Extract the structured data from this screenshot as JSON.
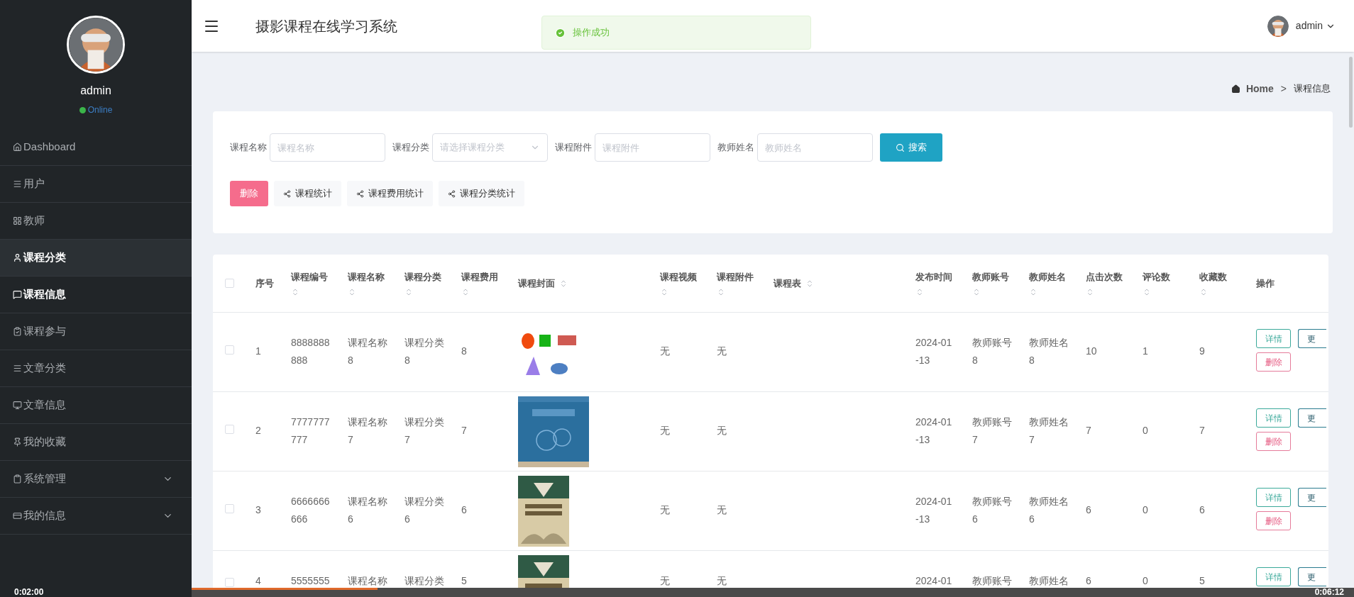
{
  "sidebar": {
    "user": {
      "name": "admin",
      "status": "Online"
    },
    "items": [
      {
        "label": "Dashboard",
        "selected": false,
        "hovered": false
      },
      {
        "label": "用户",
        "selected": false,
        "hovered": false
      },
      {
        "label": "教师",
        "selected": false,
        "hovered": false
      },
      {
        "label": "课程分类",
        "selected": true,
        "hovered": false
      },
      {
        "label": "课程信息",
        "selected": false,
        "hovered": true
      },
      {
        "label": "课程参与",
        "selected": false,
        "hovered": false
      },
      {
        "label": "文章分类",
        "selected": false,
        "hovered": false
      },
      {
        "label": "文章信息",
        "selected": false,
        "hovered": false
      },
      {
        "label": "我的收藏",
        "selected": false,
        "hovered": false
      },
      {
        "label": "系统管理",
        "selected": false,
        "hovered": false,
        "expanded": false
      },
      {
        "label": "我的信息",
        "selected": false,
        "hovered": false,
        "expanded": false
      }
    ]
  },
  "header": {
    "title": "摄影课程在线学习系统",
    "user": "admin"
  },
  "toast": {
    "message": "操作成功"
  },
  "breadcrumb": [
    "Home",
    ">",
    "课程信息"
  ],
  "search": {
    "fields": [
      {
        "label": "课程名称",
        "placeholder": "课程名称",
        "kind": "text"
      },
      {
        "label": "课程分类",
        "placeholder": "请选择课程分类",
        "kind": "select"
      },
      {
        "label": "课程附件",
        "placeholder": "课程附件",
        "kind": "text"
      },
      {
        "label": "教师姓名",
        "placeholder": "教师姓名",
        "kind": "text"
      }
    ],
    "button": "搜索"
  },
  "actions": [
    {
      "label": "删除",
      "kind": "danger"
    },
    {
      "label": "课程统计",
      "kind": "stat"
    },
    {
      "label": "课程费用统计",
      "kind": "stat"
    },
    {
      "label": "课程分类统计",
      "kind": "stat"
    }
  ],
  "table": {
    "select_all": {
      "checked": false
    },
    "columns": [
      {
        "label": "序号",
        "sortable": false
      },
      {
        "label": "课程编号",
        "sortable": true
      },
      {
        "label": "课程名称",
        "sortable": true
      },
      {
        "label": "课程分类",
        "sortable": true
      },
      {
        "label": "课程费用",
        "sortable": true
      },
      {
        "label": "课程封面",
        "sortable": true
      },
      {
        "label": "课程视频",
        "sortable": true
      },
      {
        "label": "课程附件",
        "sortable": true
      },
      {
        "label": "课程表",
        "sortable": true
      },
      {
        "label": "发布时间",
        "sortable": true
      },
      {
        "label": "教师账号",
        "sortable": true
      },
      {
        "label": "教师姓名",
        "sortable": true
      },
      {
        "label": "点击次数",
        "sortable": true
      },
      {
        "label": "评论数",
        "sortable": true
      },
      {
        "label": "收藏数",
        "sortable": true
      },
      {
        "label": "操作",
        "sortable": false
      }
    ],
    "rows": [
      {
        "checked": false,
        "cells": [
          "1",
          "8888888\n888",
          "课程名称\n8",
          "课程分类\n8",
          "8",
          "",
          "无",
          "无",
          "",
          "2024-01\n-13",
          "教师账号\n8",
          "教师姓名\n8",
          "10",
          "1",
          "9"
        ],
        "buttons": [
          "详情",
          "更",
          "删除"
        ]
      },
      {
        "checked": false,
        "cells": [
          "2",
          "7777777\n777",
          "课程名称\n7",
          "课程分类\n7",
          "7",
          "",
          "无",
          "无",
          "",
          "2024-01\n-13",
          "教师账号\n7",
          "教师姓名\n7",
          "7",
          "0",
          "7"
        ],
        "buttons": [
          "详情",
          "更",
          "删除"
        ]
      },
      {
        "checked": false,
        "cells": [
          "3",
          "6666666\n666",
          "课程名称\n6",
          "课程分类\n6",
          "6",
          "",
          "无",
          "无",
          "",
          "2024-01\n-13",
          "教师账号\n6",
          "教师姓名\n6",
          "6",
          "0",
          "6"
        ],
        "buttons": [
          "详情",
          "更",
          "删除"
        ]
      },
      {
        "checked": false,
        "cells": [
          "4",
          "5555555",
          "课程名称",
          "课程分类",
          "5",
          "",
          "无",
          "无",
          "",
          "2024-01",
          "教师账号",
          "教师姓名",
          "6",
          "0",
          "5"
        ],
        "buttons": [
          "详情",
          "更"
        ]
      }
    ]
  },
  "video_bar": {
    "elapsed": "0:02:00",
    "total": "0:06:12",
    "level": 0.16
  }
}
